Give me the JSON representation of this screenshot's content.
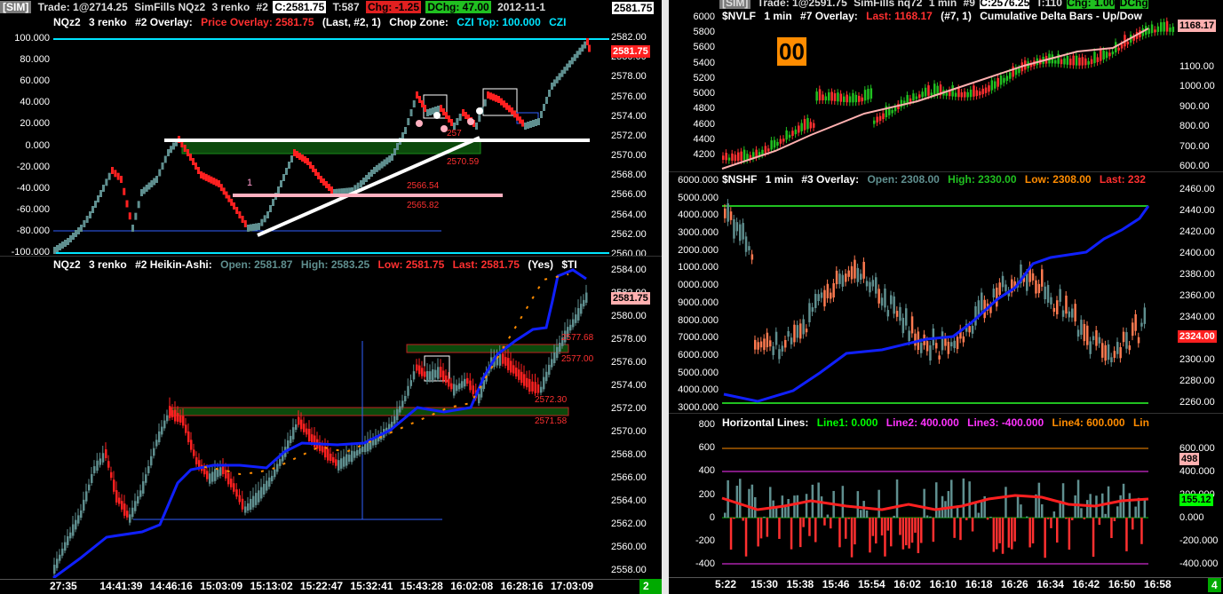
{
  "left_window": {
    "title_bar": {
      "sim": "[SIM]",
      "trade": "Trade: 1@2714.25",
      "account": "SimFills NQz2",
      "bar_type": "3 renko",
      "chart_num": "#2",
      "close": "C:2581.75",
      "ticks": "T:587",
      "chg": "Chg: -1.25",
      "dchg": "DChg: 47.00",
      "date": "2012-11-1",
      "price_tag": "2581.75"
    },
    "top_panel": {
      "header": {
        "symbol": "NQz2",
        "bar_type": "3 renko",
        "overlay": "#2 Overlay:",
        "price_overlay": "Price Overlay: 2581.75",
        "params": "(Last, #2, 1)",
        "study": "Chop Zone:",
        "czi": "CZI Top: 100.000",
        "czi2": "CZI"
      },
      "left_ticks": [
        "100.000",
        "80.000",
        "60.000",
        "40.000",
        "20.000",
        "0.000",
        "-20.000",
        "-40.000",
        "-60.000",
        "-80.000",
        "-100.000"
      ],
      "right_ticks": [
        "2582.00",
        "2580.00",
        "2578.00",
        "2576.00",
        "2574.00",
        "2572.00",
        "2570.00",
        "2568.00",
        "2566.00",
        "2564.00",
        "2562.00",
        "2560.00"
      ],
      "price_tag": "2581.75",
      "annotations": [
        "2570.59",
        "2566.54",
        "2565.82",
        "257",
        "1"
      ]
    },
    "bottom_panel": {
      "header": {
        "symbol": "NQz2",
        "bar_type": "3 renko",
        "study": "#2 Heikin-Ashi:",
        "open": "Open: 2581.87",
        "high": "High: 2583.25",
        "low": "Low: 2581.75",
        "last": "Last: 2581.75",
        "yes": "(Yes)",
        "trail": "$TI"
      },
      "right_ticks": [
        "2584.00",
        "2582.00",
        "2580.00",
        "2578.00",
        "2576.00",
        "2574.00",
        "2572.00",
        "2570.00",
        "2568.00",
        "2566.00",
        "2564.00",
        "2562.00",
        "2560.00",
        "2558.00"
      ],
      "price_tag": "2581.75",
      "annotations": [
        "2577.68",
        "2577.00",
        "2572.30",
        "2571.58"
      ]
    },
    "time_axis": [
      "27:35",
      "14:41:39",
      "14:46:16",
      "15:03:09",
      "15:13:02",
      "15:22:47",
      "15:32:41",
      "15:43:28",
      "16:02:08",
      "16:28:16",
      "17:03:09"
    ],
    "badge": "2 L"
  },
  "right_window": {
    "title_bar": {
      "sim": "[SIM]",
      "trade": "Trade: 1@2591.75",
      "account": "SimFills nq72",
      "interval": "1 min",
      "chart_num": "#9",
      "close": "C:2576.25",
      "ticks": "T:110",
      "chg": "Chg: 1.00",
      "dchg": "DChg"
    },
    "panel1": {
      "header": {
        "symbol": "$NVLF",
        "interval": "1 min",
        "overlay": "#7 Overlay:",
        "last": "Last: 1168.17",
        "params": "(#7, 1)",
        "study": "Cumulative Delta Bars - Up/Dow"
      },
      "left_ticks": [
        "6000",
        "5800",
        "5600",
        "5400",
        "5200",
        "5000",
        "4800",
        "4600",
        "4400",
        "4200"
      ],
      "right_ticks": [
        "1100.00",
        "1000.00",
        "900.00",
        "800.00",
        "700.00",
        "600.00"
      ],
      "price_tag": "1168.17",
      "orange_label": "00"
    },
    "panel2": {
      "header": {
        "symbol": "$NSHF",
        "interval": "1 min",
        "overlay": "#3 Overlay:",
        "open": "Open: 2308.00",
        "high": "High: 2330.00",
        "low": "Low: 2308.00",
        "last": "Last: 232"
      },
      "left_ticks": [
        "6000.000",
        "5000.000",
        "4000.000",
        "3000.000",
        "2000.000",
        "1000.000",
        "0000.000",
        "9000.000",
        "8000.000",
        "7000.000",
        "6000.000",
        "5000.000",
        "4000.000",
        "3000.000"
      ],
      "right_ticks": [
        "2460.00",
        "2440.00",
        "2420.00",
        "2400.00",
        "2380.00",
        "2360.00",
        "2340.00",
        "2320.00",
        "2300.00",
        "2280.00",
        "2260.00"
      ],
      "price_tag": "2324.00"
    },
    "panel3": {
      "header": {
        "study": "Horizontal Lines:",
        "line1": "Line1: 0.000",
        "line2": "Line2: 400.000",
        "line3": "Line3: -400.000",
        "line4": "Line4: 600.000",
        "line5": "Lin"
      },
      "left_ticks": [
        "800",
        "600",
        "400",
        "200",
        "0",
        "-200",
        "-400"
      ],
      "right_ticks": [
        "600.000",
        "400.000",
        "200.000",
        "0.000",
        "-200.000",
        "-400.000"
      ],
      "tag1": "498",
      "tag2": "155.12"
    },
    "time_axis": [
      "5:22",
      "15:30",
      "15:38",
      "15:46",
      "15:54",
      "16:02",
      "16:10",
      "16:18",
      "16:26",
      "16:34",
      "16:42",
      "16:50",
      "16:58"
    ],
    "badge": "4"
  },
  "colors": {
    "up": "#5f8f8f",
    "down": "#ff2020",
    "green_hdr": "#00ff00",
    "red_hdr": "#ff3030",
    "cyan": "#00e5ff",
    "magenta": "#ff33ff",
    "orange": "#ff8c00",
    "blue": "#1020ff"
  }
}
